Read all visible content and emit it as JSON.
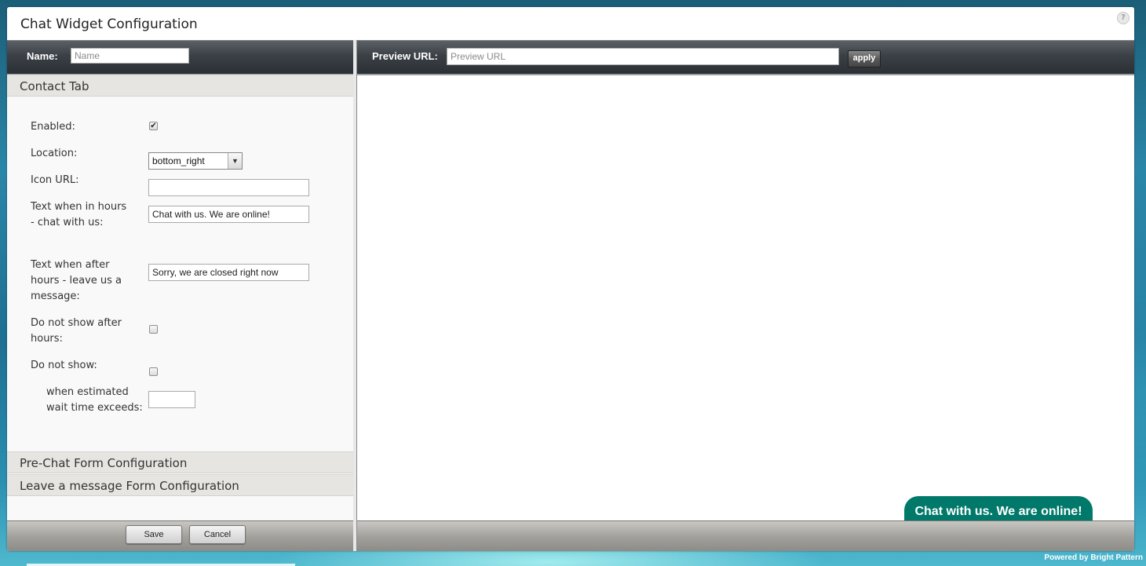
{
  "window": {
    "title": "Chat Widget Configuration",
    "help_icon": "help-icon"
  },
  "left_toolbar": {
    "name_label": "Name:",
    "name_value": "",
    "name_placeholder": "Name"
  },
  "right_toolbar": {
    "preview_label": "Preview URL:",
    "preview_value": "",
    "preview_placeholder": "Preview URL",
    "apply_label": "apply"
  },
  "sections": {
    "contact_tab": "Contact Tab",
    "pre_chat": "Pre-Chat Form Configuration",
    "leave_message": "Leave a message Form Configuration"
  },
  "contact_form": {
    "enabled_label": "Enabled:",
    "enabled_checked": true,
    "location_label": "Location:",
    "location_value": "bottom_right",
    "icon_url_label": "Icon URL:",
    "icon_url_value": "",
    "text_in_hours_label": "Text when in hours - chat with us:",
    "text_in_hours_value": "Chat with us. We are online!",
    "text_after_hours_label": "Text when after hours - leave us a message:",
    "text_after_hours_value": "Sorry, we are closed right now",
    "no_show_after_hours_label": "Do not show after hours:",
    "no_show_after_hours_checked": false,
    "no_show_label": "Do not show:",
    "no_show_checked": false,
    "wait_time_label": "when estimated wait time exceeds:",
    "wait_time_value": ""
  },
  "buttons": {
    "save": "Save",
    "cancel": "Cancel"
  },
  "preview": {
    "chat_bubble_text": "Chat with us. We are online!",
    "chat_bubble_color": "#00796b"
  },
  "footer": {
    "powered_by": "Powered by Bright Pattern"
  }
}
